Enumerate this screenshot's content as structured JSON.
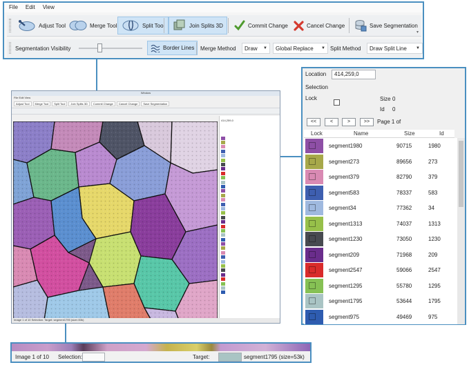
{
  "menu": [
    "File",
    "Edit",
    "View"
  ],
  "toolbar": {
    "adjust_label": "Adjust Tool",
    "merge_label": "Merge Tool",
    "split_label": "Split Tool",
    "join_label": "Join Splits 3D",
    "commit_label": "Commit Change",
    "cancel_label": "Cancel Change",
    "save_label": "Save Segmentation",
    "visibility_label": "Segmentation Visibility",
    "visibility_level": 0.33,
    "border_label": "Border Lines",
    "merge_method_label": "Merge Method",
    "merge_method_value": "Draw",
    "merge_scope_value": "Global Replace",
    "split_method_label": "Split Method",
    "split_method_value": "Draw Split Line"
  },
  "side_panel": {
    "location_label": "Location",
    "location_value": "414,259,0",
    "selection_label": "Selection",
    "lock_label": "Lock",
    "size_label": "Size",
    "size_value": "0",
    "id_label": "Id",
    "id_value": "0",
    "nav": [
      "<<",
      "<",
      ">",
      ">>"
    ],
    "page_label": "Page 1 of",
    "columns": [
      "Lock",
      "Name",
      "Size",
      "Id"
    ],
    "rows": [
      {
        "color": "#8e4fa6",
        "name": "segment1980",
        "size": "90715",
        "id": "1980"
      },
      {
        "color": "#a7a84a",
        "name": "segment273",
        "size": "89656",
        "id": "273"
      },
      {
        "color": "#d98ab3",
        "name": "segment379",
        "size": "82790",
        "id": "379"
      },
      {
        "color": "#3e5fb0",
        "name": "segment583",
        "size": "78337",
        "id": "583"
      },
      {
        "color": "#9fb9df",
        "name": "segment34",
        "size": "77362",
        "id": "34"
      },
      {
        "color": "#97c04a",
        "name": "segment1313",
        "size": "74037",
        "id": "1313"
      },
      {
        "color": "#474a50",
        "name": "segment1230",
        "size": "73050",
        "id": "1230"
      },
      {
        "color": "#6a2d8c",
        "name": "segment209",
        "size": "71968",
        "id": "209"
      },
      {
        "color": "#d92b2b",
        "name": "segment2547",
        "size": "59066",
        "id": "2547"
      },
      {
        "color": "#86c154",
        "name": "segment1295",
        "size": "55780",
        "id": "1295"
      },
      {
        "color": "#a9c4c4",
        "name": "segment1795",
        "size": "53644",
        "id": "1795"
      },
      {
        "color": "#2e5cb0",
        "name": "segment975",
        "size": "49469",
        "id": "975"
      }
    ]
  },
  "mini_app": {
    "title": "Window",
    "menu": "File  Edit  View",
    "toolbar": [
      "Adjust Tool",
      "Merge Tool",
      "Split Tool",
      "Join Splits 3D",
      "Commit Change",
      "Cancel Change",
      "Save Segmentation"
    ],
    "location_value": "414,259,0",
    "status": "Image 1 of 10    Selection:                         Target:        segment1795 (size=53k)"
  },
  "status_bar": {
    "image_label": "Image 1 of 10",
    "selection_label": "Selection:",
    "target_label": "Target:",
    "target_value": "segment1795 (size=53k)"
  }
}
